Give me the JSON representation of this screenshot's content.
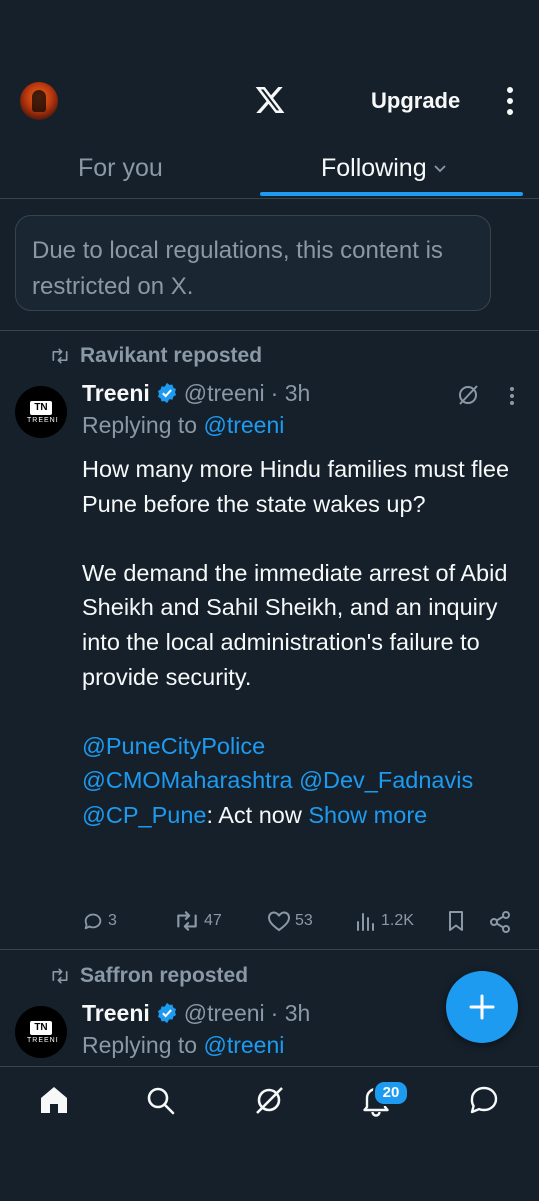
{
  "header": {
    "upgrade_label": "Upgrade"
  },
  "tabs": {
    "for_you": "For you",
    "following": "Following"
  },
  "notice": {
    "text": "Due to local regulations, this content is restricted on X."
  },
  "tweets": [
    {
      "reposted_by": "Ravikant reposted",
      "name": "Treeni",
      "handle": "@treeni",
      "time": "· 3h",
      "replying_prefix": "Replying to ",
      "replying_to": "@treeni",
      "avatar_text": "TN",
      "avatar_word": "TREENI",
      "body_p1": "How many more Hindu families must flee Pune before the state wakes up?",
      "body_p2": "We demand the immediate arrest of Abid Sheikh and Sahil Sheikh, and an inquiry into the local administration's failure to provide security.",
      "mention1": "@PuneCityPolice",
      "mention2": "@CMOMaharashtra",
      "mention3": "@Dev_Fadnavis",
      "mention4": "@CP_Pune",
      "tail": ": Act now ",
      "show_more": "Show more",
      "replies": "3",
      "reposts": "47",
      "likes": "53",
      "views": "1.2K"
    },
    {
      "reposted_by": "Saffron reposted",
      "name": "Treeni",
      "handle": "@treeni",
      "time": "· 3h",
      "replying_prefix": "Replying to ",
      "replying_to": "@treeni",
      "avatar_text": "TN",
      "avatar_word": "TREENI"
    }
  ],
  "bottom_nav": {
    "notifications_badge": "20"
  },
  "colors": {
    "background": "#15202b",
    "accent": "#1d9bf0",
    "muted": "#8b98a5",
    "border": "#38444d"
  },
  "icons": [
    "profile-avatar",
    "x-logo-icon",
    "more-vertical-icon",
    "chevron-down-icon",
    "repost-icon",
    "verified-badge-icon",
    "grok-icon",
    "reply-icon",
    "like-icon",
    "views-icon",
    "bookmark-icon",
    "share-icon",
    "plus-icon",
    "home-icon",
    "search-icon",
    "grok-nav-icon",
    "bell-icon",
    "messages-icon"
  ]
}
